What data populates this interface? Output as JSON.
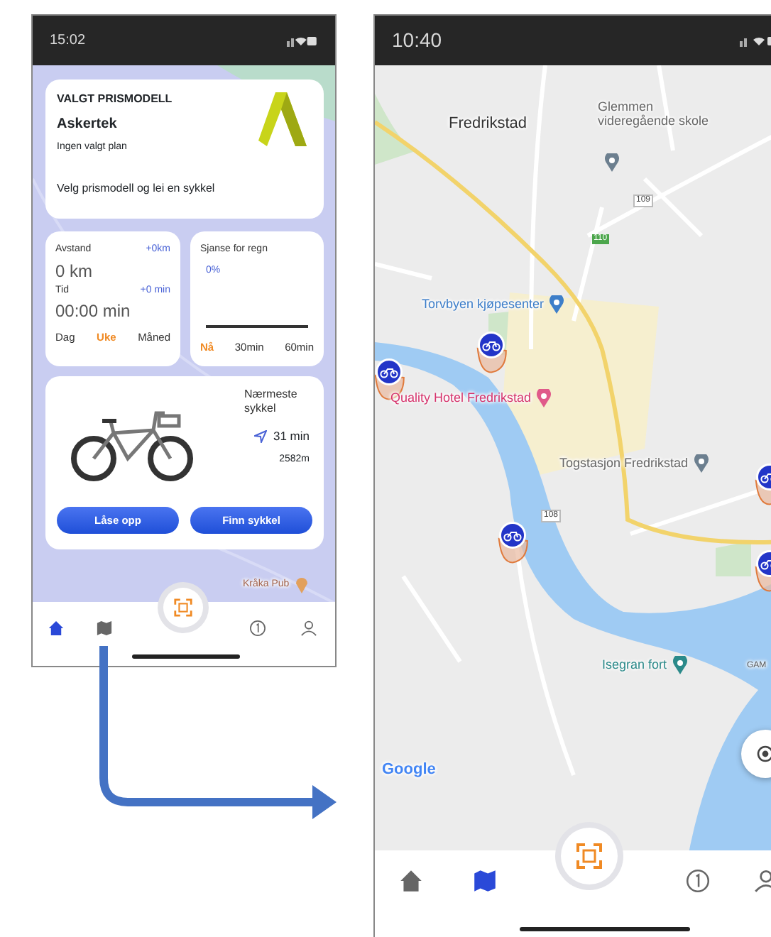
{
  "left_phone": {
    "status_time": "15:02",
    "pricing": {
      "heading": "VALGT PRISMODELL",
      "company": "Askertek",
      "plan": "Ingen valgt plan",
      "prompt": "Velg prismodell og lei en sykkel"
    },
    "stats": {
      "distance_label": "Avstand",
      "distance_delta": "+0km",
      "distance": "0 km",
      "time_label": "Tid",
      "time_delta": "+0 min",
      "time": "00:00 min",
      "periods": [
        {
          "label": "Dag",
          "selected": false
        },
        {
          "label": "Uke",
          "selected": true
        },
        {
          "label": "Måned",
          "selected": false
        }
      ]
    },
    "rain": {
      "label": "Sjanse for regn",
      "value": "0%",
      "times": [
        {
          "label": "Nå",
          "selected": true
        },
        {
          "label": "30min",
          "selected": false
        },
        {
          "label": "60min",
          "selected": false
        }
      ]
    },
    "bike": {
      "title": "Nærmeste sykkel",
      "eta": "31 min",
      "distance": "2582m",
      "buttons": [
        "Låse opp",
        "Finn sykkel"
      ]
    },
    "map_labels": [
      {
        "text": "Kråka Pub",
        "kind": "poi"
      }
    ],
    "tabs": [
      {
        "kind": "home",
        "selected": true
      },
      {
        "kind": "map",
        "selected": false
      },
      {
        "kind": "info",
        "selected": false
      },
      {
        "kind": "profile",
        "selected": false
      }
    ]
  },
  "right_phone": {
    "status_time": "10:40",
    "map_labels": [
      {
        "text": "Fredrikstad",
        "kind": "place"
      },
      {
        "text": "Glemmen videregående skole",
        "kind": "poi"
      },
      {
        "text": "109",
        "kind": "road"
      },
      {
        "text": "110",
        "kind": "highway"
      },
      {
        "text": "Torvbyen kjøpesenter",
        "kind": "shop"
      },
      {
        "text": "Quality Hotel Fredrikstad",
        "kind": "hotel"
      },
      {
        "text": "Togstasjon Fredrikstad",
        "kind": "poi"
      },
      {
        "text": "108",
        "kind": "road"
      },
      {
        "text": "Isegran fort",
        "kind": "park"
      },
      {
        "text": "GAM",
        "kind": "district"
      },
      {
        "text": "Google",
        "kind": "brand"
      }
    ],
    "tabs": [
      {
        "kind": "home",
        "selected": false
      },
      {
        "kind": "map",
        "selected": true
      },
      {
        "kind": "info",
        "selected": false
      },
      {
        "kind": "profile",
        "selected": false
      }
    ]
  }
}
